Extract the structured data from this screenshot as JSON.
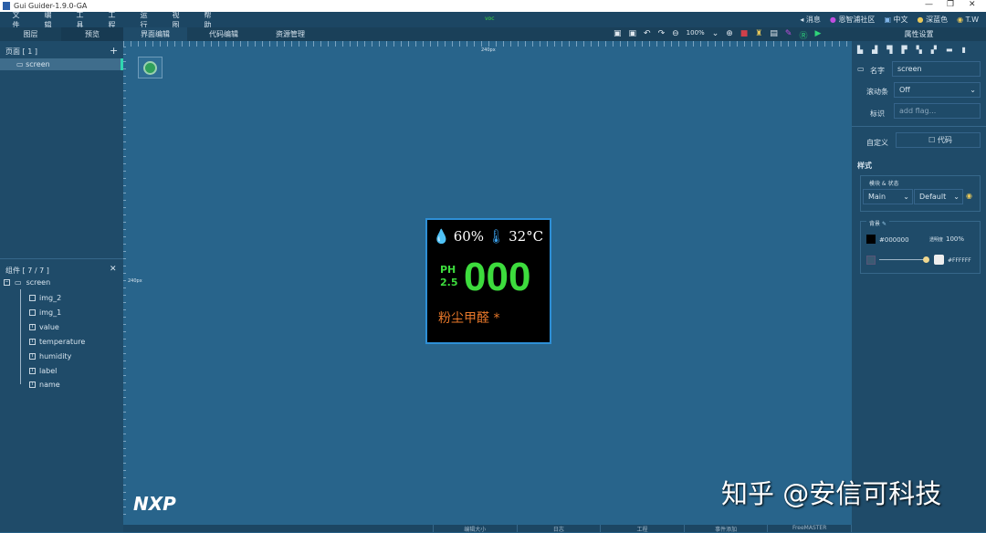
{
  "window": {
    "title": "Gui Guider-1.9.0-GA",
    "minimize": "—",
    "restore": "❐",
    "close": "✕"
  },
  "menu": [
    "文件",
    "编辑",
    "工具",
    "工程",
    "运行",
    "视图",
    "帮助"
  ],
  "center_badge": "voc",
  "menu_right": [
    {
      "icon": "speaker-icon",
      "label": "消息"
    },
    {
      "icon": "community-icon",
      "label": "恩智浦社区"
    },
    {
      "icon": "language-icon",
      "label": "中文"
    },
    {
      "icon": "palette-icon",
      "label": "深蓝色"
    },
    {
      "icon": "user-icon",
      "label": "T.W"
    }
  ],
  "tabs": {
    "layers": "图层",
    "preview": "预览",
    "design": "界面编辑",
    "code": "代码编辑",
    "resources": "资源管理",
    "properties": "属性设置"
  },
  "toolbar": {
    "zoom": "100%"
  },
  "pages": {
    "header": "页面 [ 1 ]",
    "add": "+",
    "items": [
      "screen"
    ]
  },
  "widgets": {
    "header": "组件 [ 7 / 7 ]",
    "root": "screen",
    "items": [
      {
        "icon": "image",
        "label": "img_2"
      },
      {
        "icon": "image",
        "label": "img_1"
      },
      {
        "icon": "text",
        "label": "value"
      },
      {
        "icon": "text",
        "label": "temperature"
      },
      {
        "icon": "text",
        "label": "humidity"
      },
      {
        "icon": "text",
        "label": "label"
      },
      {
        "icon": "text",
        "label": "name"
      }
    ]
  },
  "ruler": {
    "h_label": "240px",
    "v_label": "240px"
  },
  "device": {
    "humidity": "60%",
    "temperature": "32°C",
    "ph_top": "PH",
    "ph_bottom": "2.5",
    "value": "000",
    "name": "粉尘甲醛 *",
    "value_color": "#3ddc3d",
    "name_color": "#e8782a"
  },
  "logo": "NXP",
  "watermark": "知乎 @安信可科技",
  "properties": {
    "name_label": "名字",
    "name_value": "screen",
    "scroll_label": "滚动条",
    "scroll_value": "Off",
    "flag_label": "标识",
    "flag_placeholder": "add flag...",
    "custom_label": "自定义",
    "code_button": "代码",
    "style_header": "样式",
    "part_state": "模块 & 状态",
    "part": "Main",
    "state": "Default",
    "bg_header": "背景",
    "bg_color": "#000000",
    "opacity_label": "透明度",
    "opacity": "100%",
    "grad_color": "#FFFFFF"
  },
  "statusbar": [
    "编辑大小",
    "日志",
    "工程",
    "事件添加",
    "FreeMASTER"
  ]
}
